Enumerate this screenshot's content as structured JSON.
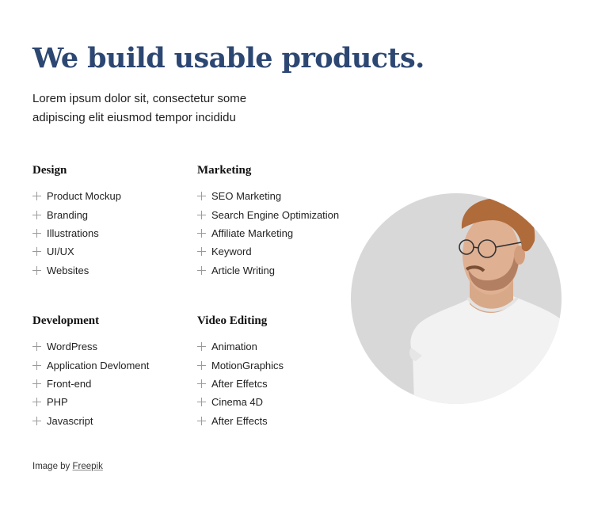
{
  "hero": {
    "title": "We build usable products.",
    "description": "Lorem ipsum dolor sit, consectetur some adipiscing elit eiusmod tempor incididu"
  },
  "services": [
    {
      "heading": "Design",
      "items": [
        "Product Mockup",
        "Branding",
        "Illustrations",
        "UI/UX",
        "Websites"
      ]
    },
    {
      "heading": "Marketing",
      "items": [
        "SEO Marketing",
        "Search Engine Optimization",
        "Affiliate Marketing",
        "Keyword",
        "Article Writing"
      ]
    },
    {
      "heading": "Development",
      "items": [
        "WordPress",
        "Application Devloment",
        "Front-end",
        "PHP",
        "Javascript"
      ]
    },
    {
      "heading": "Video Editing",
      "items": [
        "Animation",
        "MotionGraphics",
        "After Effetcs",
        "Cinema 4D",
        "After Effects"
      ]
    }
  ],
  "photo": {
    "alt": "Man with glasses in white t-shirt looking sideways"
  },
  "credit": {
    "prefix": "Image by",
    "link": "Freepik"
  },
  "colors": {
    "title": "#2d4773",
    "icon": "#9a9a9a",
    "photo_bg": "#d8d8d8"
  }
}
